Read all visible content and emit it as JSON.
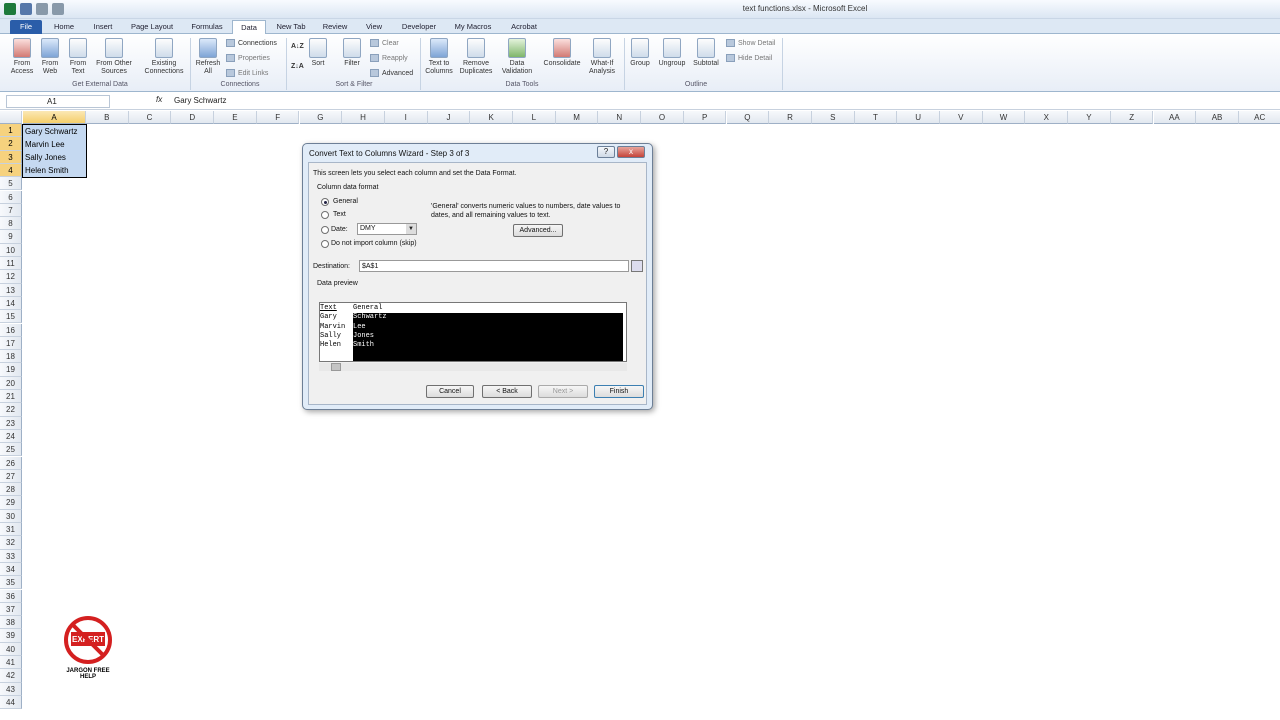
{
  "window": {
    "title": "text functions.xlsx - Microsoft Excel"
  },
  "tabs": [
    "File",
    "Home",
    "Insert",
    "Page Layout",
    "Formulas",
    "Data",
    "New Tab",
    "Review",
    "View",
    "Developer",
    "My Macros",
    "Acrobat"
  ],
  "ribbon": {
    "from_access": "From Access",
    "from_web": "From Web",
    "from_text": "From Text",
    "from_other": "From Other Sources",
    "existing": "Existing Connections",
    "refresh": "Refresh All",
    "connections": "Connections",
    "properties": "Properties",
    "edit_links": "Edit Links",
    "sort": "Sort",
    "filter": "Filter",
    "clear": "Clear",
    "reapply": "Reapply",
    "advanced": "Advanced",
    "text_to_columns": "Text to Columns",
    "remove_duplicates": "Remove Duplicates",
    "data_validation": "Data Validation",
    "consolidate": "Consolidate",
    "what_if": "What-If Analysis",
    "group": "Group",
    "ungroup": "Ungroup",
    "subtotal": "Subtotal",
    "show_detail": "Show Detail",
    "hide_detail": "Hide Detail",
    "groups": {
      "external": "Get External Data",
      "connections": "Connections",
      "sort_filter": "Sort & Filter",
      "data_tools": "Data Tools",
      "outline": "Outline"
    }
  },
  "formula_bar": {
    "name_box": "A1",
    "fx": "fx",
    "value": "Gary Schwartz"
  },
  "columns": [
    "A",
    "B",
    "C",
    "D",
    "E",
    "F",
    "G",
    "H",
    "I",
    "J",
    "K",
    "L",
    "M",
    "N",
    "O",
    "P",
    "Q",
    "R",
    "S",
    "T",
    "U",
    "V",
    "W",
    "X",
    "Y",
    "Z",
    "AA",
    "AB",
    "AC"
  ],
  "rows": [
    "1",
    "2",
    "3",
    "4",
    "5",
    "6",
    "7",
    "8",
    "9",
    "10",
    "11",
    "12",
    "13",
    "14",
    "15",
    "16",
    "17",
    "18",
    "19",
    "20",
    "21",
    "22",
    "23",
    "24",
    "25",
    "26",
    "27",
    "28",
    "29",
    "30",
    "31",
    "32",
    "33",
    "34",
    "35",
    "36",
    "37",
    "38",
    "39",
    "40",
    "41",
    "42",
    "43",
    "44"
  ],
  "cells": [
    "Gary Schwartz",
    "Marvin Lee",
    "Sally Jones",
    "Helen Smith"
  ],
  "dialog": {
    "title": "Convert Text to Columns Wizard - Step 3 of 3",
    "help": "?",
    "close": "x",
    "intro": "This screen lets you select each column and set the Data Format.",
    "column_format_label": "Column data format",
    "opt_general": "General",
    "opt_text": "Text",
    "opt_date": "Date:",
    "date_value": "DMY",
    "opt_skip": "Do not import column (skip)",
    "general_desc": "'General' converts numeric values to numbers, date values to dates, and all remaining values to text.",
    "advanced_button": "Advanced...",
    "destination_label": "Destination:",
    "destination_value": "$A$1",
    "preview_label": "Data preview",
    "preview_headers": [
      "Text",
      "General"
    ],
    "preview_col1": [
      "Gary",
      "Marvin",
      "Sally",
      "Helen"
    ],
    "preview_col2": [
      "Schwartz",
      "Lee",
      "Jones",
      "Smith"
    ],
    "cancel": "Cancel",
    "back": "< Back",
    "next": "Next >",
    "finish": "Finish"
  },
  "logo": {
    "badge": "EXPERT",
    "caption": "JARGON FREE HELP"
  }
}
